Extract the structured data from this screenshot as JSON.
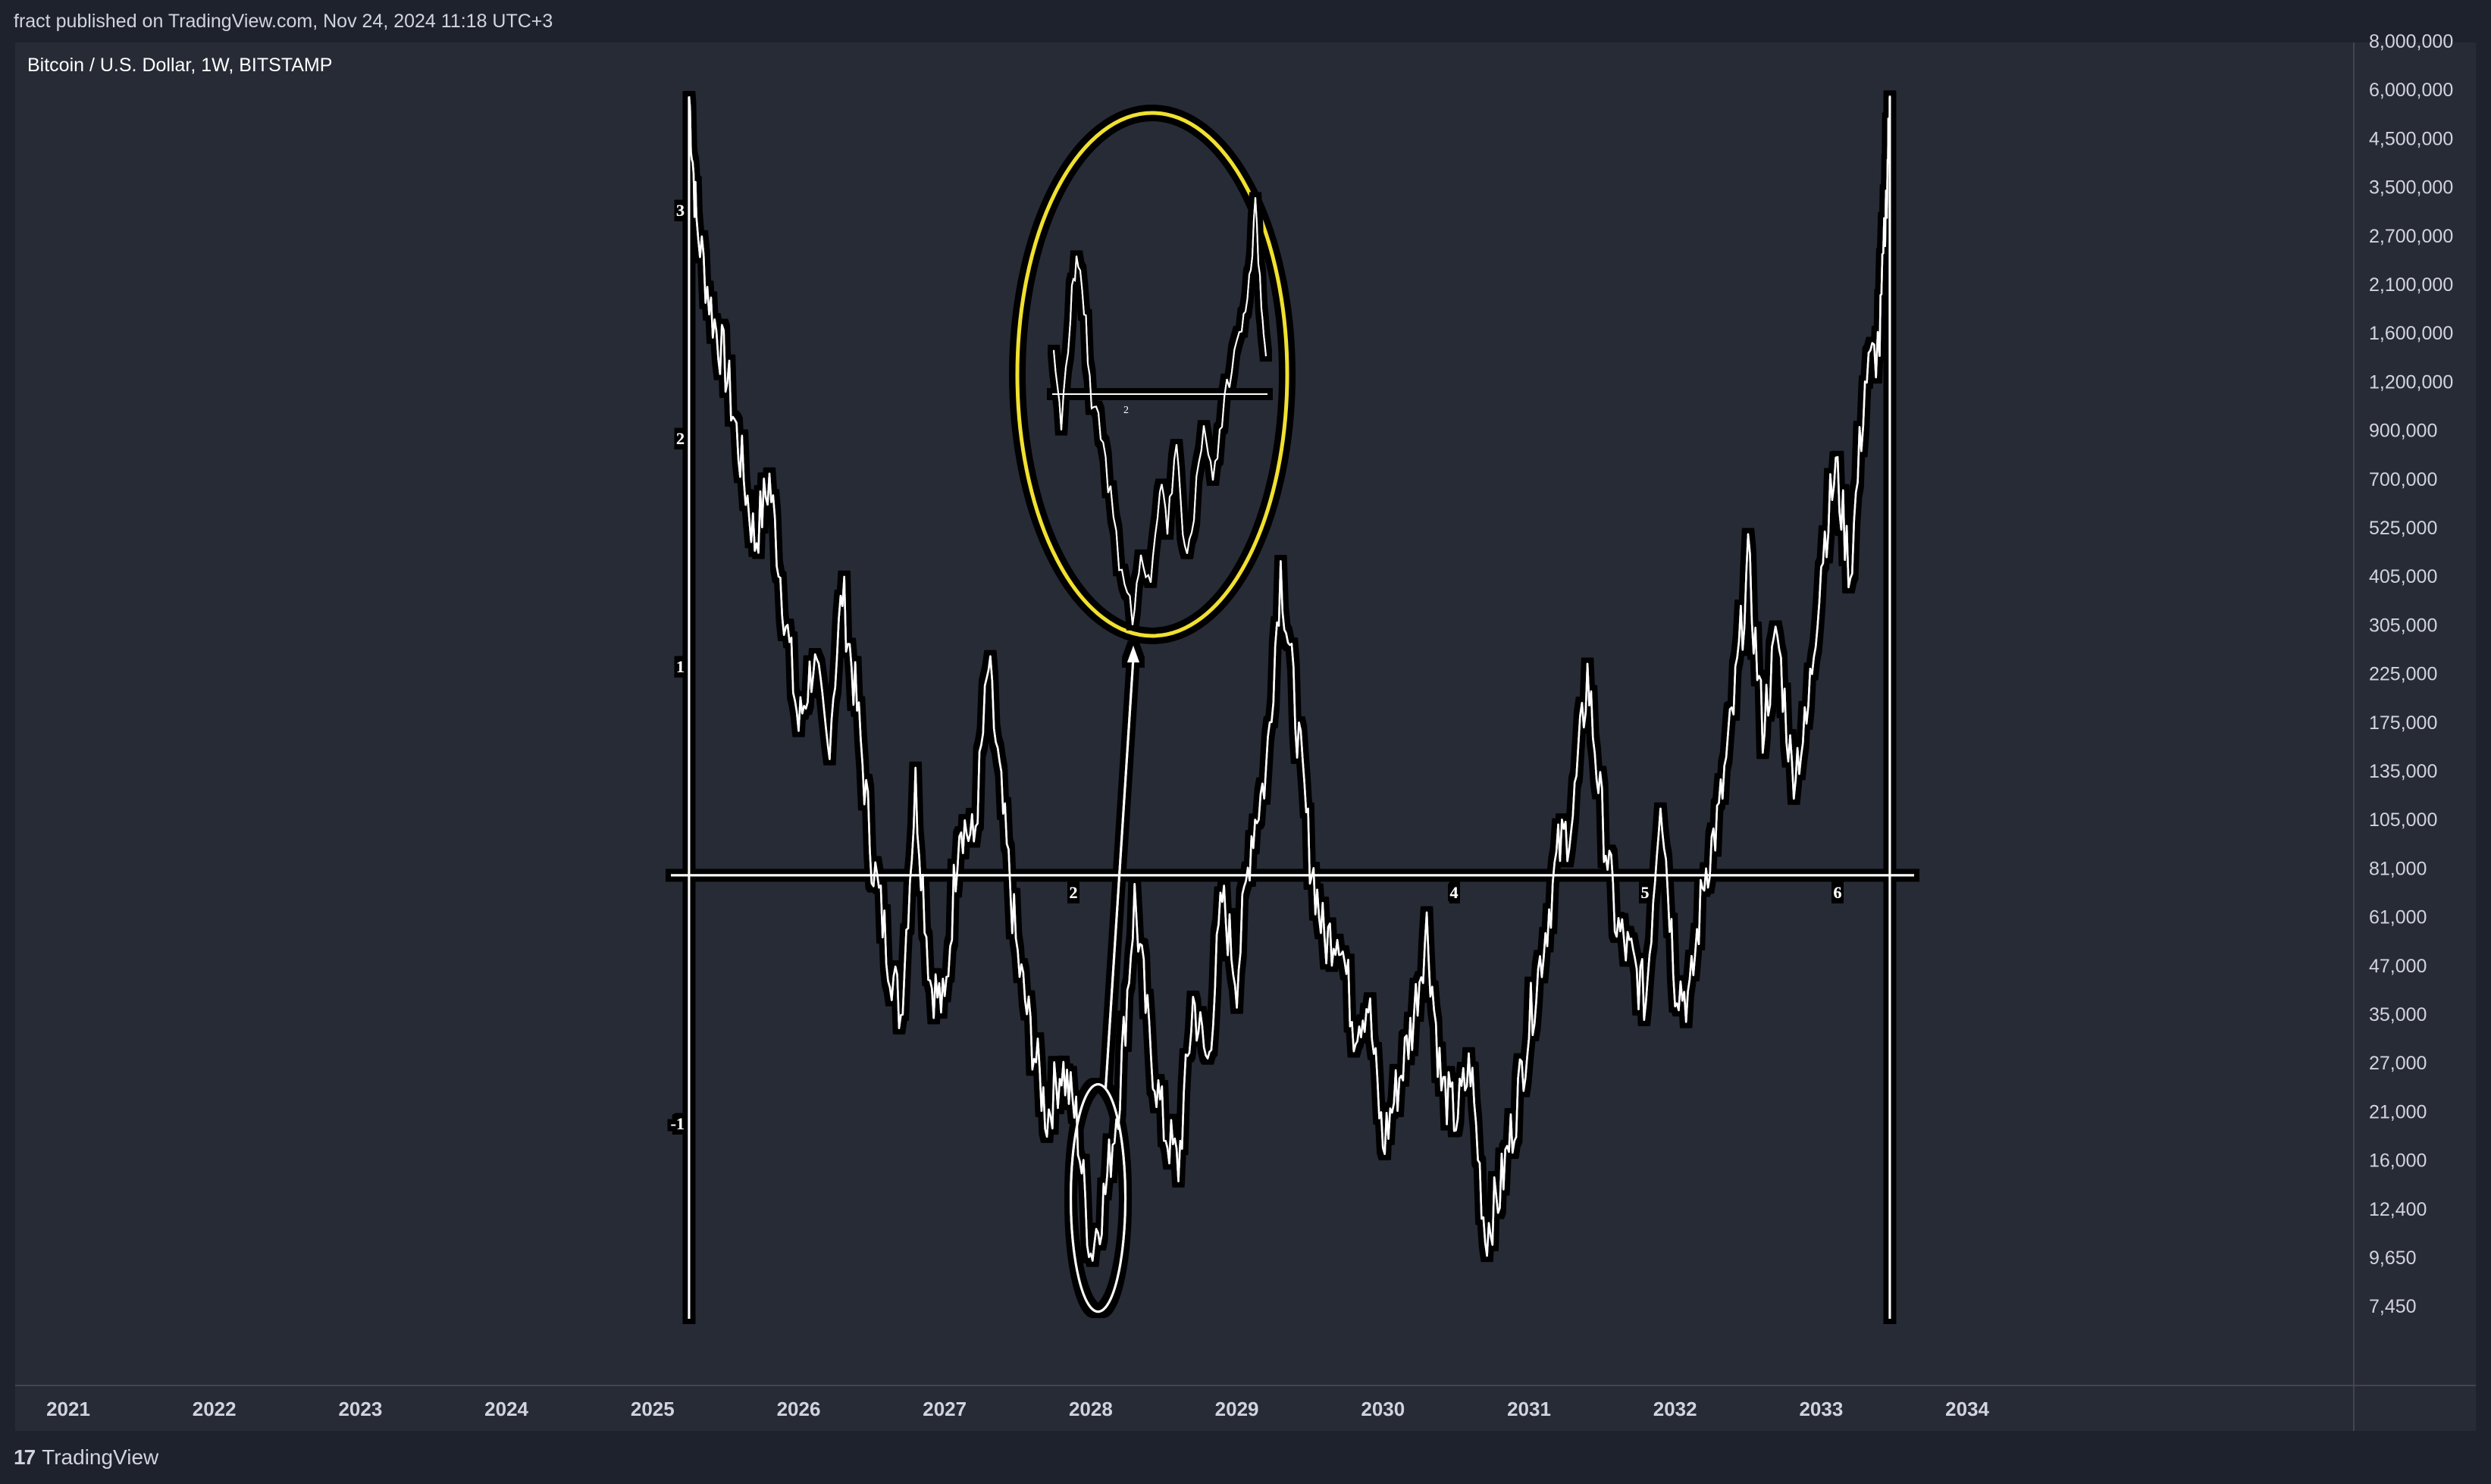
{
  "header": {
    "published_text": "fract published on TradingView.com, Nov 24, 2024 11:18 UTC+3"
  },
  "symbol": {
    "title": "Bitcoin / U.S. Dollar, 1W, BITSTAMP"
  },
  "footer": {
    "brand": "TradingView",
    "logo_glyph": "17"
  },
  "colors": {
    "background": "#1e222d",
    "pane": "#272b36",
    "axis_text": "#d1d4dc",
    "overlay_stroke": "#ffffff",
    "overlay_shadow": "#000000",
    "highlight_ellipse": "#f0e030"
  },
  "chart_data": {
    "type": "line",
    "y_scale": "log",
    "y_ticks": [
      "8,000,000",
      "6,000,000",
      "4,500,000",
      "3,500,000",
      "2,700,000",
      "2,100,000",
      "1,600,000",
      "1,200,000",
      "900,000",
      "700,000",
      "525,000",
      "405,000",
      "305,000",
      "225,000",
      "175,000",
      "135,000",
      "105,000",
      "81,000",
      "61,000",
      "47,000",
      "35,000",
      "27,000",
      "21,000",
      "16,000",
      "12,400",
      "9,650",
      "7,450"
    ],
    "x_ticks": [
      "2021",
      "2022",
      "2023",
      "2024",
      "2025",
      "2026",
      "2027",
      "2028",
      "2029",
      "2030",
      "2031",
      "2032",
      "2033",
      "2034"
    ],
    "overlay": {
      "description_labels": [
        "3",
        "2",
        "1",
        "-1"
      ],
      "baseline_labels": [
        "2",
        "4",
        "5",
        "6"
      ],
      "inset_label": "2",
      "series": [
        {
          "values": [
            [
              2025.25,
              5800000
            ],
            [
              2025.3,
              2900000
            ],
            [
              2025.4,
              1800000
            ],
            [
              2025.5,
              1300000
            ],
            [
              2025.6,
              800000
            ],
            [
              2025.7,
              500000
            ],
            [
              2025.8,
              700000
            ],
            [
              2025.9,
              350000
            ],
            [
              2026.0,
              180000
            ],
            [
              2026.1,
              260000
            ],
            [
              2026.2,
              160000
            ],
            [
              2026.3,
              380000
            ],
            [
              2026.4,
              200000
            ],
            [
              2026.5,
              90000
            ],
            [
              2026.6,
              55000
            ],
            [
              2026.7,
              37000
            ],
            [
              2026.8,
              130000
            ],
            [
              2026.9,
              45000
            ],
            [
              2027.0,
              38000
            ],
            [
              2027.1,
              110000
            ],
            [
              2027.2,
              95000
            ],
            [
              2027.3,
              250000
            ],
            [
              2027.4,
              110000
            ],
            [
              2027.5,
              50000
            ],
            [
              2027.6,
              32000
            ],
            [
              2027.7,
              21000
            ],
            [
              2027.8,
              28000
            ],
            [
              2027.9,
              21000
            ],
            [
              2028.0,
              10000
            ],
            [
              2028.1,
              14000
            ],
            [
              2028.2,
              25000
            ],
            [
              2028.3,
              70000
            ],
            [
              2028.4,
              32000
            ],
            [
              2028.5,
              20000
            ],
            [
              2028.6,
              16000
            ],
            [
              2028.7,
              40000
            ],
            [
              2028.8,
              28000
            ],
            [
              2028.9,
              70000
            ],
            [
              2029.0,
              45000
            ],
            [
              2029.1,
              100000
            ],
            [
              2029.2,
              140000
            ],
            [
              2029.3,
              430000
            ],
            [
              2029.4,
              200000
            ],
            [
              2029.5,
              90000
            ],
            [
              2029.6,
              55000
            ],
            [
              2029.7,
              60000
            ],
            [
              2029.8,
              35000
            ],
            [
              2029.9,
              40000
            ],
            [
              2030.0,
              18000
            ],
            [
              2030.1,
              25000
            ],
            [
              2030.2,
              35000
            ],
            [
              2030.3,
              60000
            ],
            [
              2030.4,
              25000
            ],
            [
              2030.5,
              21000
            ],
            [
              2030.6,
              28000
            ],
            [
              2030.7,
              11000
            ],
            [
              2030.8,
              14000
            ],
            [
              2030.9,
              21000
            ],
            [
              2031.0,
              35000
            ],
            [
              2031.1,
              55000
            ],
            [
              2031.2,
              90000
            ],
            [
              2031.3,
              110000
            ],
            [
              2031.4,
              240000
            ],
            [
              2031.5,
              110000
            ],
            [
              2031.6,
              60000
            ],
            [
              2031.7,
              50000
            ],
            [
              2031.8,
              40000
            ],
            [
              2031.9,
              130000
            ],
            [
              2032.0,
              45000
            ],
            [
              2032.1,
              40000
            ],
            [
              2032.2,
              80000
            ],
            [
              2032.3,
              110000
            ],
            [
              2032.4,
              200000
            ],
            [
              2032.5,
              440000
            ],
            [
              2032.6,
              180000
            ],
            [
              2032.7,
              300000
            ],
            [
              2032.8,
              140000
            ],
            [
              2032.9,
              180000
            ],
            [
              2033.0,
              450000
            ],
            [
              2033.1,
              750000
            ],
            [
              2033.2,
              420000
            ],
            [
              2033.3,
              1200000
            ],
            [
              2033.4,
              1500000
            ],
            [
              2033.45,
              3500000
            ],
            [
              2033.47,
              5800000
            ]
          ]
        }
      ]
    }
  }
}
